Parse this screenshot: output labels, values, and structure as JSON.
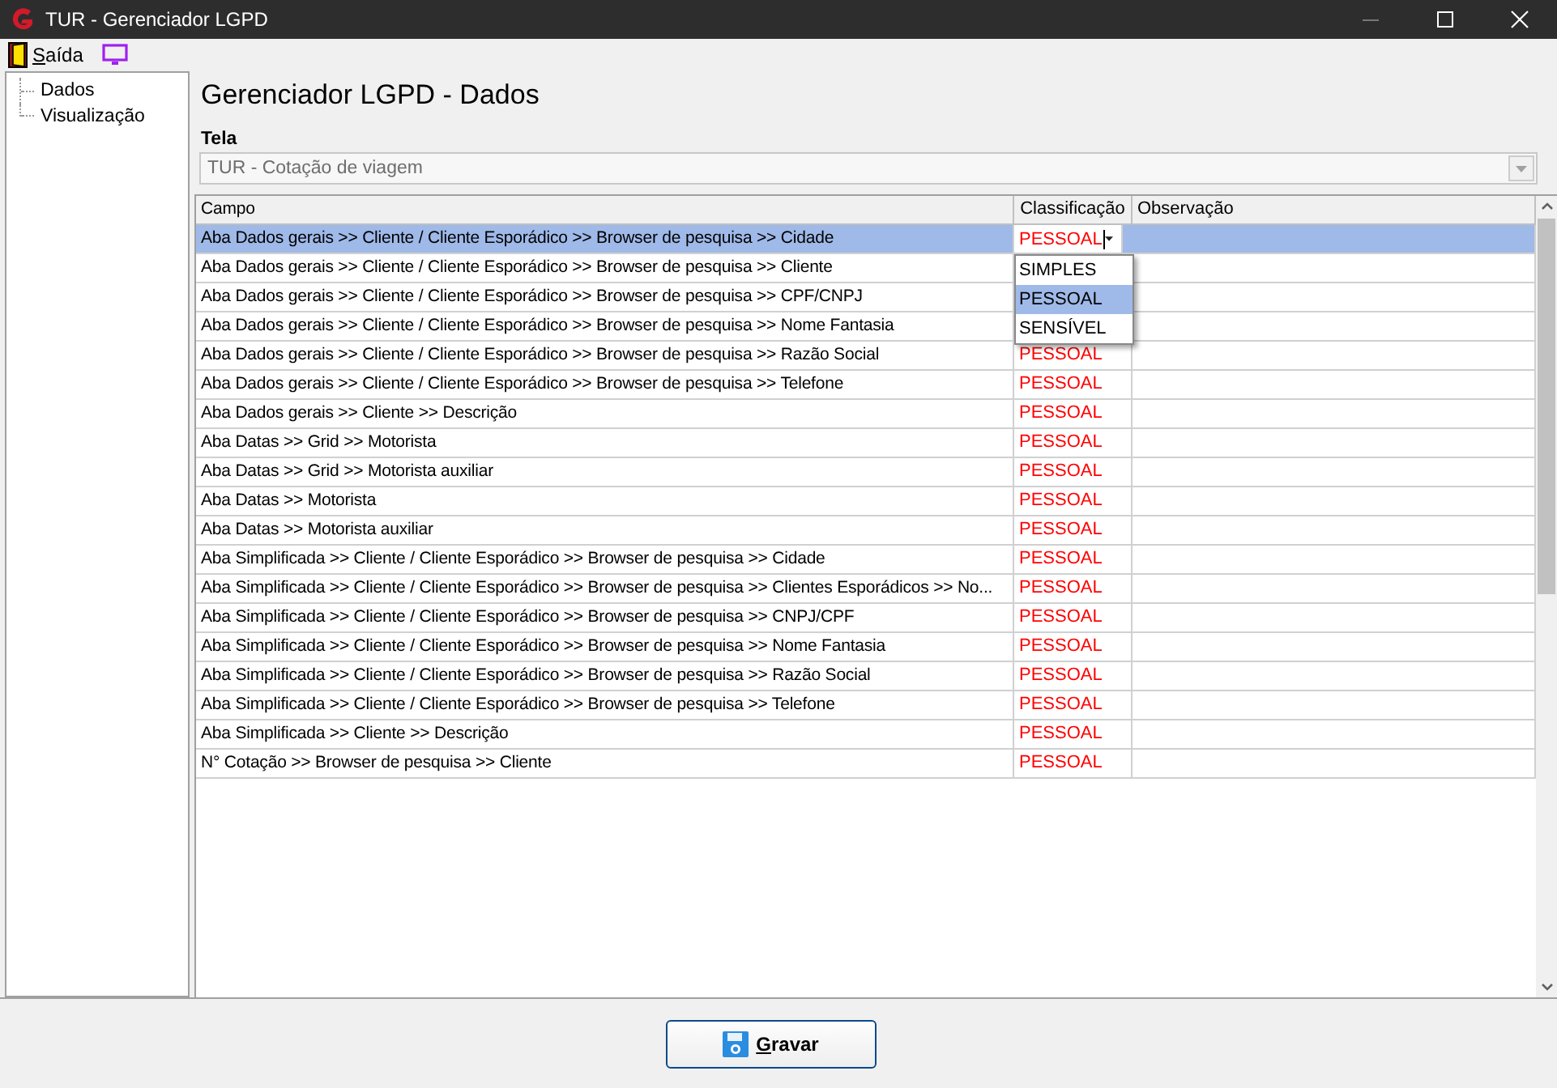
{
  "window": {
    "title": "TUR - Gerenciador LGPD"
  },
  "menu": [
    {
      "label": "Saída"
    }
  ],
  "tree": [
    {
      "label": "Dados",
      "selected": false
    },
    {
      "label": "Visualização",
      "selected": false
    }
  ],
  "heading": "Gerenciador LGPD - Dados",
  "screen_field": {
    "label": "Tela",
    "value": "TUR - Cotação de viagem",
    "disabled": true
  },
  "table": {
    "columns": [
      "Campo",
      "Classificação",
      "Observação"
    ],
    "rows": [
      {
        "campo": "Aba Dados gerais >> Cliente / Cliente Esporádico >> Browser de pesquisa >> Cidade",
        "classificacao": "PESSOAL",
        "selected": true,
        "editing": true
      },
      {
        "campo": "Aba Dados gerais >> Cliente / Cliente Esporádico >> Browser de pesquisa >> Cliente",
        "selected": false
      },
      {
        "campo": "Aba Dados gerais >> Cliente / Cliente Esporádico >> Browser de pesquisa >> CPF/CNPJ",
        "selected": false
      },
      {
        "campo": "Aba Dados gerais >> Cliente / Cliente Esporádico >> Browser de pesquisa >> Nome Fantasia",
        "selected": false
      },
      {
        "campo": "Aba Dados gerais >> Cliente / Cliente Esporádico >> Browser de pesquisa >> Razão Social",
        "classificacao": "PESSOAL",
        "selected": false
      },
      {
        "campo": "Aba Dados gerais >> Cliente / Cliente Esporádico >> Browser de pesquisa >> Telefone",
        "classificacao": "PESSOAL",
        "selected": false
      },
      {
        "campo": "Aba Dados gerais >> Cliente >> Descrição",
        "classificacao": "PESSOAL",
        "selected": false
      },
      {
        "campo": "Aba Datas >> Grid >> Motorista",
        "classificacao": "PESSOAL",
        "selected": false
      },
      {
        "campo": "Aba Datas >> Grid >> Motorista auxiliar",
        "classificacao": "PESSOAL",
        "selected": false
      },
      {
        "campo": "Aba Datas >> Motorista",
        "classificacao": "PESSOAL",
        "selected": false
      },
      {
        "campo": "Aba Datas >> Motorista auxiliar",
        "classificacao": "PESSOAL",
        "selected": false
      },
      {
        "campo": "Aba Simplificada >> Cliente / Cliente Esporádico >> Browser de pesquisa >> Cidade",
        "classificacao": "PESSOAL",
        "selected": false
      },
      {
        "campo": "Aba Simplificada >> Cliente / Cliente Esporádico >> Browser de pesquisa >> Clientes Esporádicos >> No...",
        "classificacao": "PESSOAL",
        "selected": false
      },
      {
        "campo": "Aba Simplificada >> Cliente / Cliente Esporádico >> Browser de pesquisa >> CNPJ/CPF",
        "classificacao": "PESSOAL",
        "selected": false
      },
      {
        "campo": "Aba Simplificada >> Cliente / Cliente Esporádico >> Browser de pesquisa >> Nome Fantasia",
        "classificacao": "PESSOAL",
        "selected": false
      },
      {
        "campo": "Aba Simplificada >> Cliente / Cliente Esporádico >> Browser de pesquisa >> Razão Social",
        "classificacao": "PESSOAL",
        "selected": false
      },
      {
        "campo": "Aba Simplificada >> Cliente / Cliente Esporádico >> Browser de pesquisa >> Telefone",
        "classificacao": "PESSOAL",
        "selected": false
      },
      {
        "campo": "Aba Simplificada >> Cliente >> Descrição",
        "classificacao": "PESSOAL",
        "selected": false
      },
      {
        "campo": "N° Cotação >> Browser de pesquisa >> Cliente",
        "classificacao": "PESSOAL",
        "selected": false
      }
    ],
    "dropdown_options": [
      {
        "label": "SIMPLES",
        "selected": false
      },
      {
        "label": "PESSOAL",
        "selected": true
      },
      {
        "label": "SENSÍVEL",
        "selected": false
      }
    ]
  },
  "save_button": {
    "label": "Gravar"
  }
}
